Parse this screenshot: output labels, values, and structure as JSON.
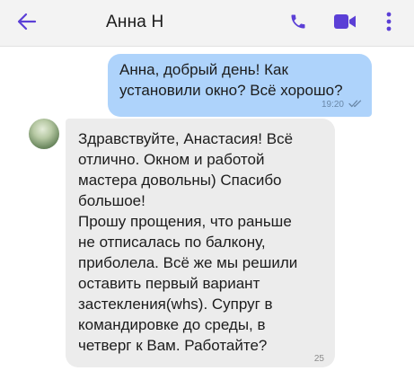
{
  "header": {
    "contact_name": "Анна Н",
    "back_icon": "arrow-left-icon",
    "call_icon": "phone-icon",
    "video_icon": "video-camera-icon",
    "menu_icon": "more-vertical-icon",
    "accent_color": "#5b3fd6"
  },
  "messages": [
    {
      "direction": "outgoing",
      "text": "Анна, добрый день! Как\nустановили окно? Всё хорошо?",
      "time": "19:20",
      "status_icon": "double-check-icon",
      "bubble_color": "#aed3fb"
    },
    {
      "direction": "incoming",
      "text": "Здравствуйте, Анастасия! Всё\nотлично. Окном и работой\nмастера довольны) Спасибо\nбольшое!\nПрошу прощения, что раньше\nне отписалась по балкону,\nприболела. Всё же мы решили\nоставить первый вариант\nзастекления(whs). Супруг в\nкомандировке до среды, в\nчетверг к Вам. Работайте?",
      "time": "25",
      "bubble_color": "#ececec"
    }
  ]
}
